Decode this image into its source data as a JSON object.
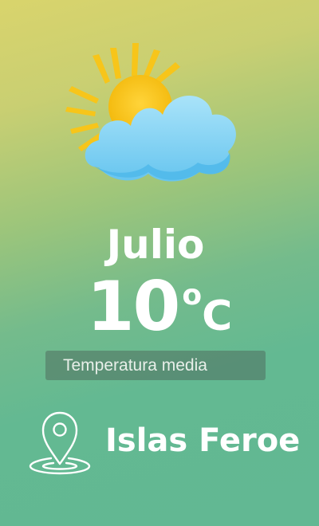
{
  "weather": {
    "icon": "sun-behind-cloud-icon",
    "month": "Julio",
    "temperature": "10",
    "degree_symbol": "o",
    "unit": "C",
    "caption": "Temperatura media"
  },
  "location": {
    "icon": "location-pin-icon",
    "name": "Islas Feroe"
  },
  "colors": {
    "background_top": "#d9d46c",
    "background_bottom": "#62b893",
    "sun": "#f7c51a",
    "cloud": "#7cd0f2",
    "text": "#ffffff"
  }
}
